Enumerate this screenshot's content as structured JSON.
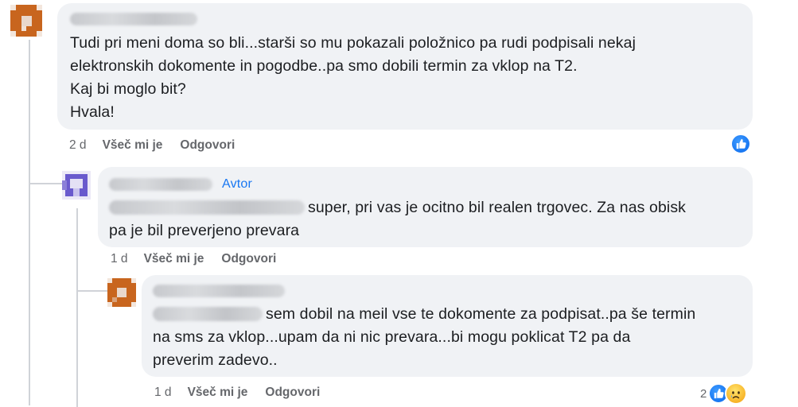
{
  "comments": [
    {
      "author_label": "Avtor",
      "text_lines": [
        "Tudi pri meni doma so bli...starši so mu pokazali položnico pa rudi podpisali nekaj",
        "elektronskih dokomente in pogodbe..pa smo dobili termin za vklop na T2.",
        "Kaj bi moglo bit?",
        "Hvala!"
      ],
      "time": "2 d",
      "like_label": "Všeč mi je",
      "reply_label": "Odgovori",
      "reaction_icon": "like-icon"
    },
    {
      "badge": "Avtor",
      "text_lines": [
        "super, pri vas je ocitno bil realen trgovec. Za nas obisk",
        "pa je bil preverjeno prevara"
      ],
      "time": "1 d",
      "like_label": "Všeč mi je",
      "reply_label": "Odgovori"
    },
    {
      "text_lines": [
        "sem dobil na meil vse te dokomente za podpisat..pa še termin",
        "na sms za vklop...upam da ni nic prevara...bi mogu poklicat T2 pa da",
        "preverim zadevo.."
      ],
      "time": "1 d",
      "like_label": "Všeč mi je",
      "reply_label": "Odgovori",
      "reaction_count": "2",
      "reaction_icons": [
        "like-icon",
        "sad-face-icon"
      ]
    }
  ],
  "colors": {
    "bubble": "#f0f2f5",
    "accent": "#1877f2",
    "meta": "#65676b",
    "avatar_orange": "#c8651e",
    "avatar_purple": "#6a5acd"
  }
}
